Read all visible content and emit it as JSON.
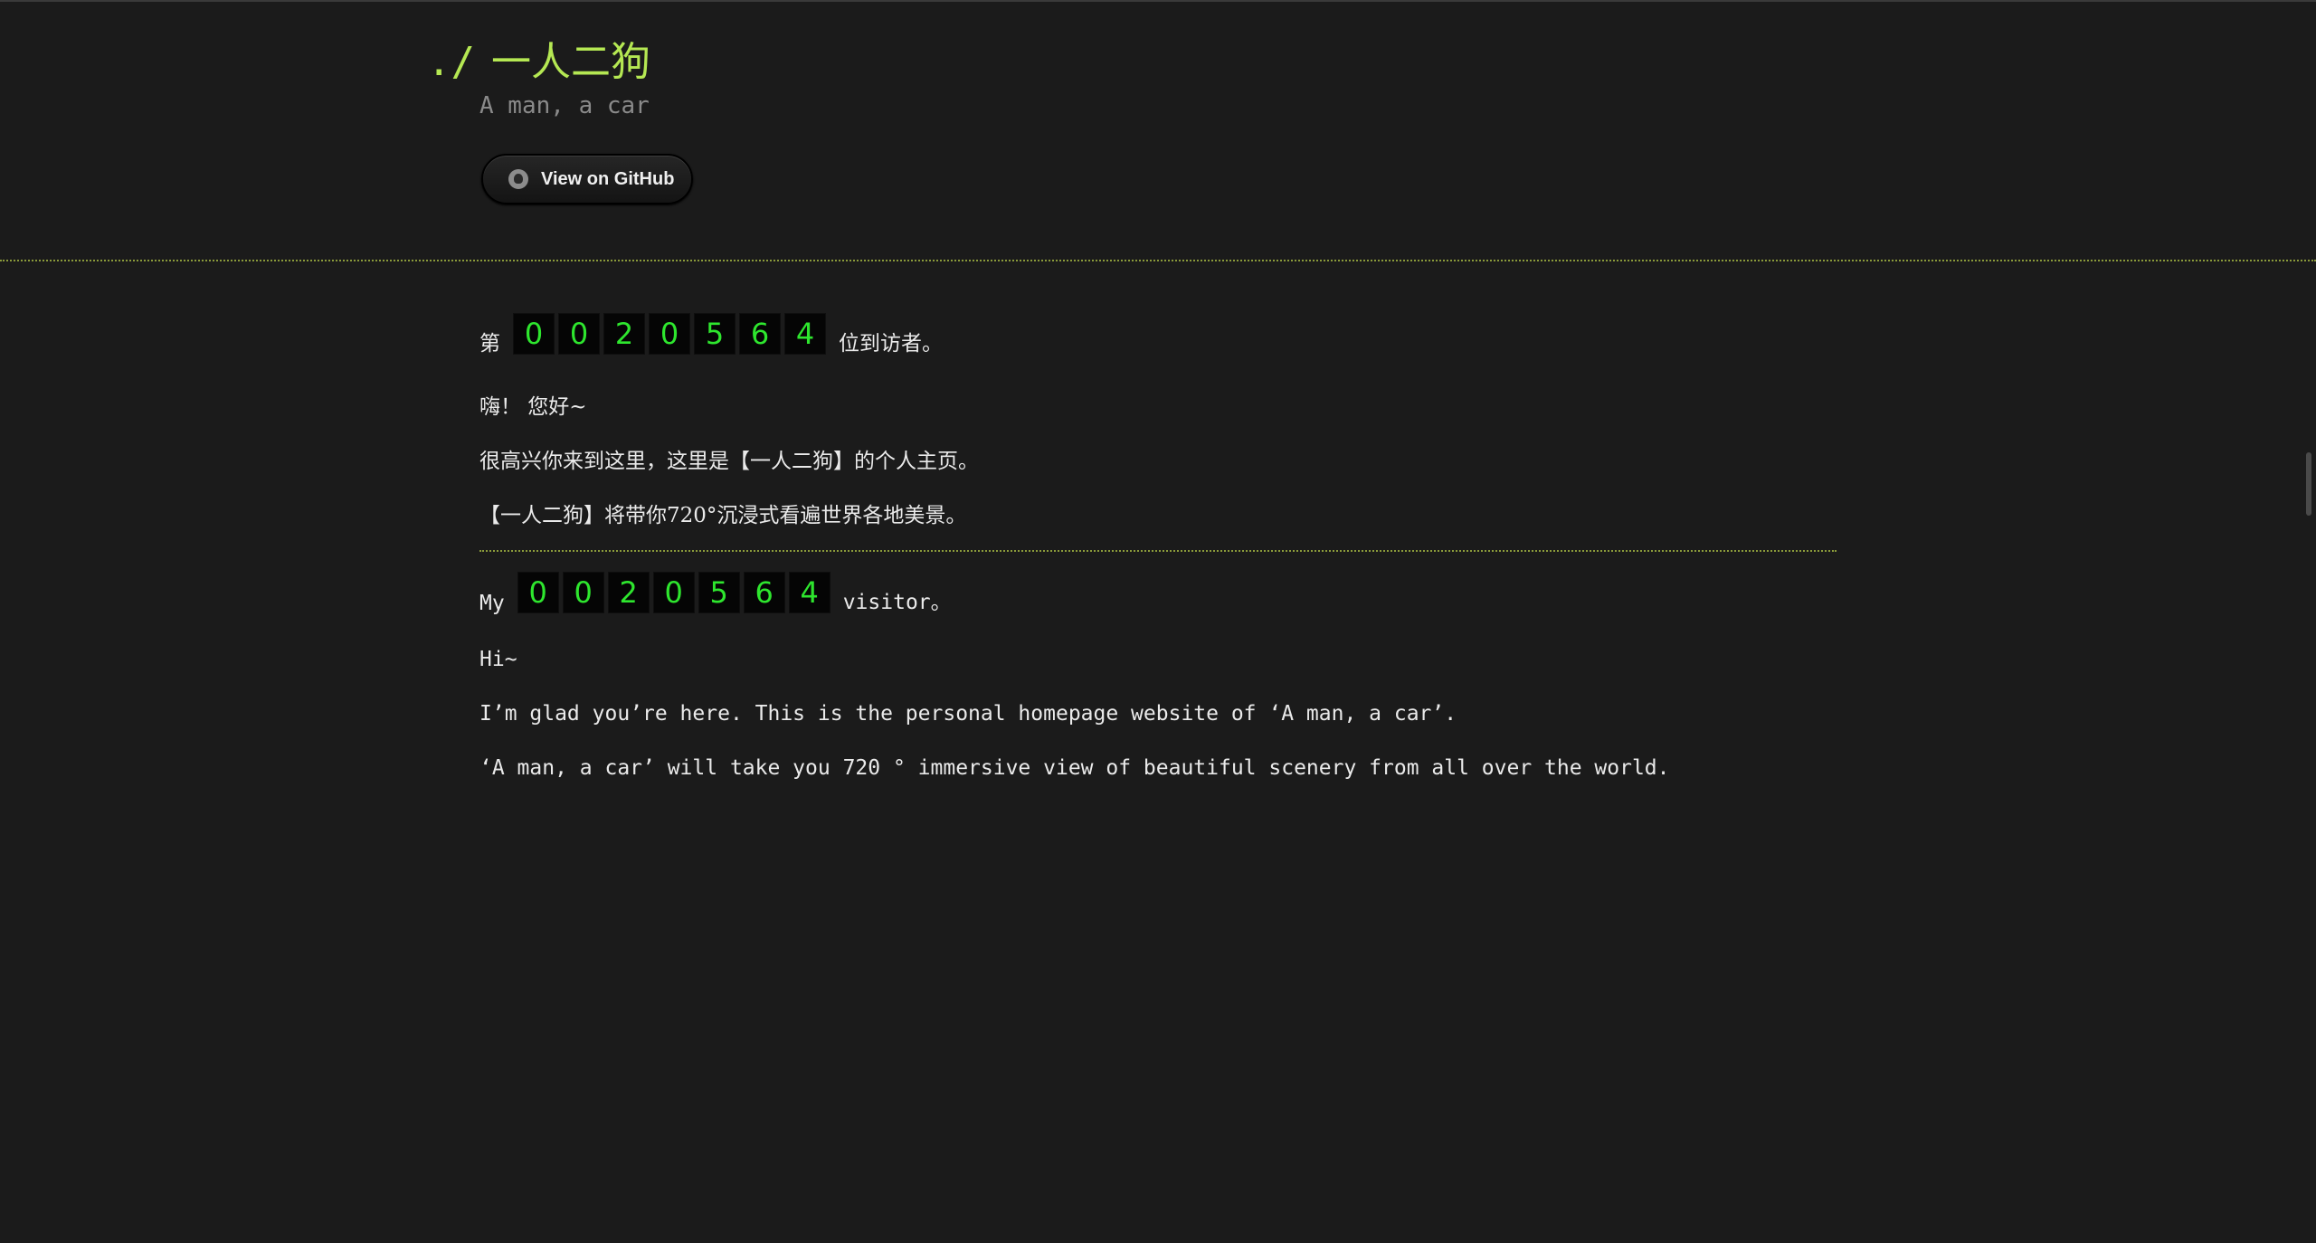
{
  "header": {
    "prompt": "./",
    "title": "一人二狗",
    "subtitle": "A man, a car",
    "github_button": "View on GitHub"
  },
  "chinese": {
    "counter_prefix": "第",
    "counter_suffix": "位到访者。",
    "counter_digits": [
      "0",
      "0",
      "2",
      "0",
      "5",
      "6",
      "4"
    ],
    "greeting": "嗨！ 您好~",
    "line1": "很高兴你来到这里，这里是【一人二狗】的个人主页。",
    "line2": "【一人二狗】将带你720°沉浸式看遍世界各地美景。"
  },
  "english": {
    "counter_prefix": "My",
    "counter_suffix": "visitor。",
    "counter_digits": [
      "0",
      "0",
      "2",
      "0",
      "5",
      "6",
      "4"
    ],
    "greeting": "Hi~",
    "line1": "I’m glad you’re here. This is the personal homepage website of ‘A man, a car’.",
    "line2": "‘A man, a car’ will take you 720 ° immersive view of beautiful scenery from all over the world."
  },
  "colors": {
    "title": "#b5e853",
    "digit": "#2ee62e",
    "divider": "#8a9a3a",
    "background": "#1b1b1b"
  }
}
